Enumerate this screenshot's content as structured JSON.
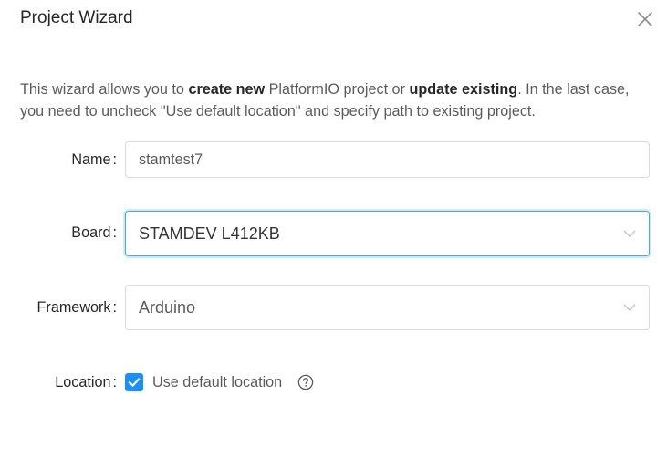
{
  "dialog": {
    "title": "Project Wizard",
    "close_icon": "close-icon"
  },
  "intro": {
    "part1": "This wizard allows you to ",
    "bold1": "create new",
    "part2": " PlatformIO project or ",
    "bold2": "update existing",
    "part3": ". In the last case, you need to uncheck \"Use default location\" and specify path to existing project."
  },
  "form": {
    "name_label": "Name",
    "name_value": "stamtest7",
    "board_label": "Board",
    "board_value": "STAMDEV L412KB",
    "framework_label": "Framework",
    "framework_value": "Arduino",
    "location_label": "Location",
    "location_checkbox_label": "Use default location",
    "location_checked": true,
    "colon": ":"
  },
  "colors": {
    "accent": "#1890ff",
    "focus_border": "#40a9ff",
    "border": "#d9d9d9"
  }
}
